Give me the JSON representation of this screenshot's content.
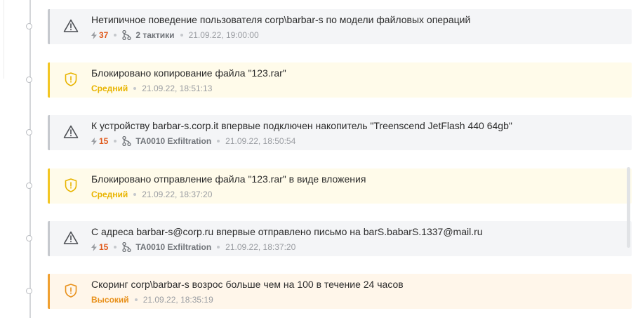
{
  "events": [
    {
      "kind": "incident",
      "title": "Нетипичное поведение пользователя corp\\barbar-s по модели файловых операций",
      "score": "37",
      "tactic": "2 тактики",
      "time": "21.09.22, 19:00:00"
    },
    {
      "kind": "block-medium",
      "title": "Блокировано копирование файла \"123.rar\"",
      "severity": "Средний",
      "time": "21.09.22, 18:51:13"
    },
    {
      "kind": "incident",
      "title": "К устройству barbar-s.corp.it впервые подключен накопитель \"Treenscend JetFlash 440 64gb\"",
      "score": "15",
      "tactic": "TA0010 Exfiltration",
      "time": "21.09.22, 18:50:54"
    },
    {
      "kind": "block-medium",
      "title": "Блокировано отправление файла \"123.rar\" в виде вложения",
      "severity": "Средний",
      "time": "21.09.22, 18:37:20"
    },
    {
      "kind": "incident",
      "title": "С адреса barbar-s@corp.ru впервые отправлено письмо на barS.babarS.1337@mail.ru",
      "score": "15",
      "tactic": "TA0010 Exfiltration",
      "time": "21.09.22, 18:37:20"
    },
    {
      "kind": "block-high",
      "title": "Скоринг corp\\barbar-s возрос больше чем на 100 в течение 24 часов",
      "severity": "Высокий",
      "time": "21.09.22, 18:35:19"
    }
  ],
  "colors": {
    "score": "#e05a1c",
    "medium": "#e8b400",
    "high": "#e8901a"
  },
  "icons": {
    "incident": "warning-triangle-icon",
    "block": "shield-warning-icon",
    "score": "bolt-icon",
    "tactic": "branch-icon"
  }
}
